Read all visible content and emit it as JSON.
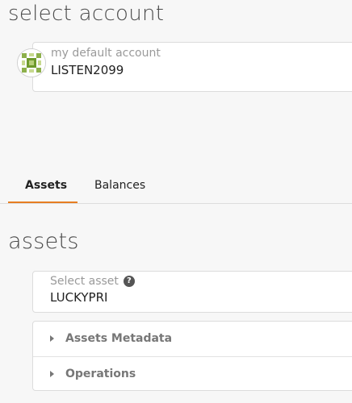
{
  "account": {
    "heading": "select account",
    "caption": "my default account",
    "value": "LISTEN2099",
    "avatar_icon": "identicon-avatar"
  },
  "tabs": [
    {
      "label": "Assets",
      "active": true
    },
    {
      "label": "Balances",
      "active": false
    }
  ],
  "assets": {
    "heading": "assets",
    "select_caption": "Select asset",
    "help_icon": "question-circle-icon",
    "select_value": "LUCKYPRI",
    "accordion": [
      {
        "label": "Assets Metadata",
        "icon": "caret-right-icon"
      },
      {
        "label": "Operations",
        "icon": "caret-right-icon"
      }
    ]
  },
  "colors": {
    "accent": "#e67e22",
    "background": "#f7f7f7",
    "card": "#ffffff",
    "identicon": "#8db04b"
  }
}
